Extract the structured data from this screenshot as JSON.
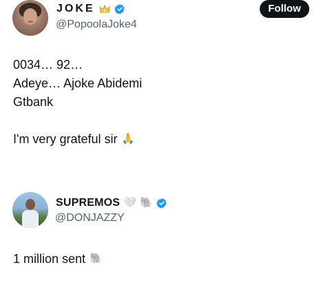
{
  "tweet": {
    "author_name": "JOKE",
    "author_handle": "@PopoolaJoke4",
    "follow_label": "Follow",
    "lines": [
      "0034… 92…",
      "Adeye… Ajoke Abidemi",
      "Gtbank",
      "I'm very grateful sir"
    ],
    "emoji_pray": "🙏"
  },
  "reply": {
    "author_name": "SUPREMOS",
    "author_handle": "@DONJAZZY",
    "text": "1 million sent",
    "emoji_heart": "🤍",
    "emoji_elephant": "🐘"
  },
  "colors": {
    "verified": "#1d9bf0",
    "text": "#0f1419",
    "secondary": "#536471",
    "follow_bg": "#0f1419"
  },
  "icons": [
    "verified-badge-icon",
    "crown-icon",
    "pray-emoji",
    "heart-emoji",
    "elephant-emoji"
  ]
}
